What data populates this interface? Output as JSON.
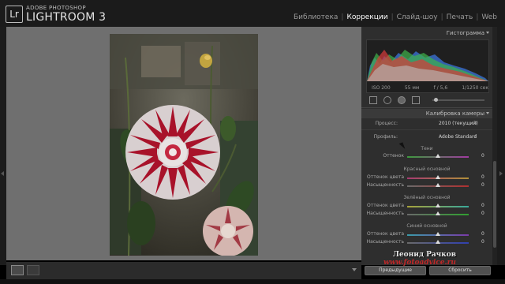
{
  "app": {
    "logo": "Lr",
    "brand_small": "ADOBE PHOTOSHOP",
    "brand_big": "LIGHTROOM 3"
  },
  "modules": [
    {
      "label": "Библиотека",
      "active": false
    },
    {
      "label": "Коррекции",
      "active": true
    },
    {
      "label": "Слайд-шоу",
      "active": false
    },
    {
      "label": "Печать",
      "active": false
    },
    {
      "label": "Web",
      "active": false
    }
  ],
  "histogram": {
    "title": "Гистограмма",
    "iso": "ISO 200",
    "focal": "55 мм",
    "aperture": "f / 5,6",
    "shutter": "1/1250 сек"
  },
  "calibration": {
    "title": "Калибровка камеры",
    "process_label": "Процесс:",
    "process_value": "2010 (текущий)",
    "profile_label": "Профиль:",
    "profile_value": "Adobe Standard",
    "sections": [
      {
        "title": "Тени",
        "sliders": [
          {
            "label": "Оттенок",
            "value": "0",
            "gradient": "linear-gradient(90deg,#3d9a3d,#a23aa2)"
          }
        ]
      },
      {
        "title": "Красный основной",
        "sliders": [
          {
            "label": "Оттенок цвета",
            "value": "0",
            "gradient": "linear-gradient(90deg,#a53a70,#b0903a)"
          },
          {
            "label": "Насыщенность",
            "value": "0",
            "gradient": "linear-gradient(90deg,#6a6a6a,#b03030)"
          }
        ]
      },
      {
        "title": "Зелёный основной",
        "sliders": [
          {
            "label": "Оттенок цвета",
            "value": "0",
            "gradient": "linear-gradient(90deg,#a8a23a,#3aa89a)"
          },
          {
            "label": "Насыщенность",
            "value": "0",
            "gradient": "linear-gradient(90deg,#6a6a6a,#30a030)"
          }
        ]
      },
      {
        "title": "Синий основной",
        "sliders": [
          {
            "label": "Оттенок цвета",
            "value": "0",
            "gradient": "linear-gradient(90deg,#3a9aa8,#7a3aa8)"
          },
          {
            "label": "Насыщенность",
            "value": "0",
            "gradient": "linear-gradient(90deg,#6a6a6a,#3040b0)"
          }
        ]
      }
    ]
  },
  "footer": {
    "previous": "Предыдущие",
    "reset": "Сбросить"
  },
  "watermark": {
    "name": "Леонид Рачков",
    "site": "www.fotoadvice.ru"
  },
  "colors": {
    "accent_active": "#ffffff",
    "panel_bg": "#2e2e2e",
    "canvas_bg": "#6f6f6f",
    "watermark_site": "#c02828"
  }
}
